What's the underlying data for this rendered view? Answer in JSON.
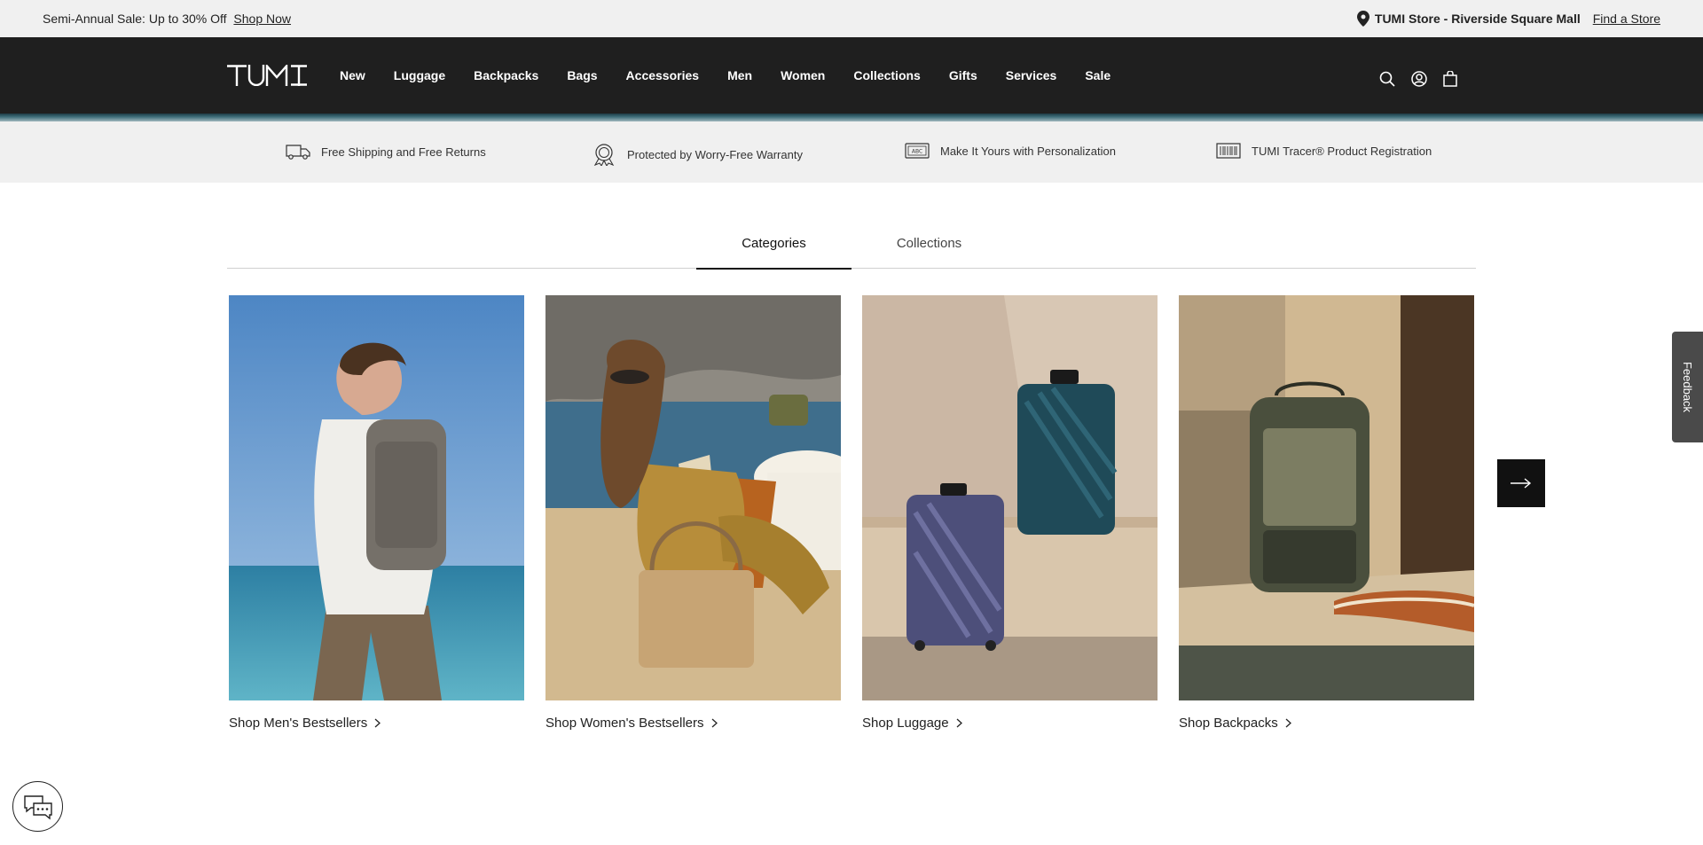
{
  "promo": {
    "text": "Semi-Annual Sale: Up to 30% Off",
    "link": "Shop Now",
    "store_name": "TUMI Store - Riverside Square Mall",
    "find_store": "Find a Store"
  },
  "header": {
    "logo": "TUMI",
    "nav": [
      "New",
      "Luggage",
      "Backpacks",
      "Bags",
      "Accessories",
      "Men",
      "Women",
      "Collections",
      "Gifts",
      "Services",
      "Sale"
    ],
    "icons": [
      "search-icon",
      "account-icon",
      "bag-icon"
    ]
  },
  "benefits": [
    {
      "label": "Free Shipping and Free Returns",
      "icon": "truck-icon"
    },
    {
      "label": "Protected by Worry-Free Warranty",
      "icon": "warranty-badge-icon"
    },
    {
      "label": "Make It Yours with Personalization",
      "icon": "abc-tag-icon"
    },
    {
      "label": "TUMI Tracer® Product Registration",
      "icon": "barcode-icon"
    }
  ],
  "tabs": {
    "active": "Categories",
    "inactive": "Collections"
  },
  "cards": [
    {
      "label": "Shop Men's Bestsellers"
    },
    {
      "label": "Shop Women's Bestsellers"
    },
    {
      "label": "Shop Luggage"
    },
    {
      "label": "Shop Backpacks"
    }
  ],
  "feedback": "Feedback"
}
